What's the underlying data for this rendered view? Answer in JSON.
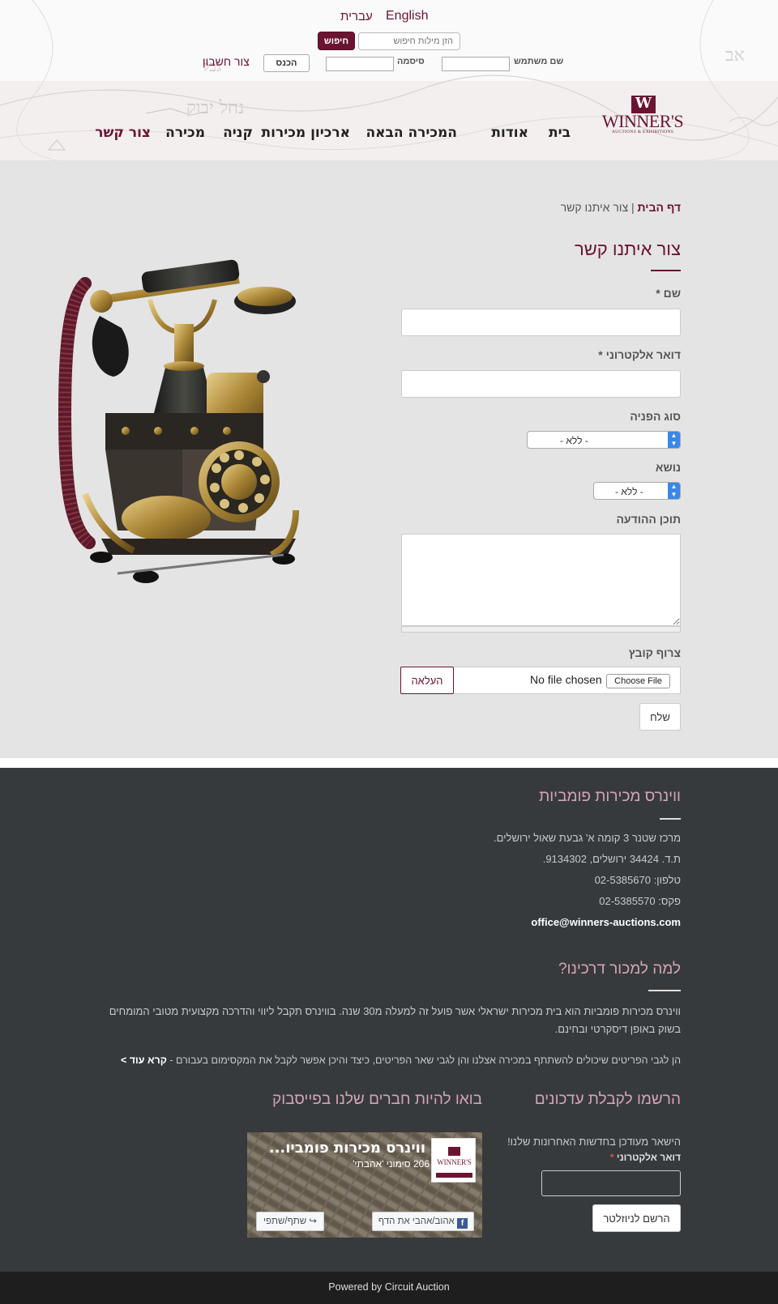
{
  "top_bar": {
    "lang_english": "English",
    "lang_hebrew": "עברית",
    "search_placeholder": "הזן מילות חיפוש",
    "search_button": "חיפוש",
    "username_label": "שם משתמש",
    "password_label": "סיסמה",
    "login_button": "הכנס",
    "create_account": "צור חשבון"
  },
  "logo": {
    "letter": "W",
    "name": "WINNER'S",
    "tagline": "AUCTIONS & EXHIBITIONS"
  },
  "nav": {
    "items": [
      {
        "label": "בית",
        "active": false
      },
      {
        "label": "אודות",
        "active": false
      },
      {
        "label": "המכירה הבאה",
        "active": false
      },
      {
        "label": "ארכיון מכירות",
        "active": false
      },
      {
        "label": "קניה",
        "active": false
      },
      {
        "label": "מכירה",
        "active": false
      },
      {
        "label": "צור קשר",
        "active": true
      }
    ]
  },
  "breadcrumb": {
    "home": "דף הבית",
    "separator": "|",
    "current": "צור איתנו קשר"
  },
  "form": {
    "title": "צור איתנו קשר",
    "name_label": "שם *",
    "email_label": "דואר אלקטרוני *",
    "inquiry_type_label": "סוג הפניה",
    "inquiry_type_value": "- ללא -",
    "subject_label": "נושא",
    "subject_value": "- ללא -",
    "message_label": "תוכן ההודעה",
    "attach_label": "צרוף קובץ",
    "file_status": "No file chosen",
    "choose_file_button": "Choose File",
    "upload_button": "העלאה",
    "send_button": "שלח"
  },
  "footer": {
    "company_heading": "ווינרס מכירות פומביות",
    "address": "מרכז שטנר 3 קומה א' גבעת שאול ירושלים.",
    "po_box": "ת.ד. 34424 ירושלים, 9134302.",
    "phone": "טלפון: 02-5385670",
    "fax": "פקס: 02-5385570",
    "email": "office@winners-auctions.com",
    "why_heading": "למה למכור דרכינו?",
    "about_text": "ווינרס מכירות פומביות הוא בית מכירות ישראלי אשר פועל זה למעלה מ30 שנה. בווינרס תקבל ליווי והדרכה מקצועית מטובי המומחים בשוק באופן דיסקרטי ובחינם.",
    "buyers_text": "הן לגבי הפריטים שיכולים להשתתף במכירה אצלנו והן לגבי שאר הפריטים, כיצד והיכן אפשר לקבל את המקסימום בעבורם -",
    "read_more": "קרא עוד >",
    "newsletter_heading": "הרשמו לקבלת עדכונים",
    "newsletter_text": "הישאר מעודכן בחדשות האחרונות שלנו!",
    "newsletter_email_label": "דואר אלקטרוני",
    "newsletter_required": "*",
    "newsletter_button": "הרשם לניוזלטר",
    "facebook_heading": "בואו להיות חברים שלנו בפייסבוק",
    "fb_page_name": "ווינרס מכירות פומביו...",
    "fb_likes": "206 סימוני 'אהבתי'",
    "fb_like_button": "אהוב/אהבי את הדף",
    "fb_share_button": "שתף/שתפי",
    "powered_by": "Powered by Circuit Auction"
  },
  "colors": {
    "brand": "#6b1432",
    "footer_bg": "#373a3c",
    "footer_heading": "#d3a4b5",
    "content_bg": "#e4e4e4"
  },
  "icons": [
    "header-map-decoration",
    "phone-image",
    "facebook-icon",
    "share-arrow-icon",
    "select-arrow-icon"
  ]
}
